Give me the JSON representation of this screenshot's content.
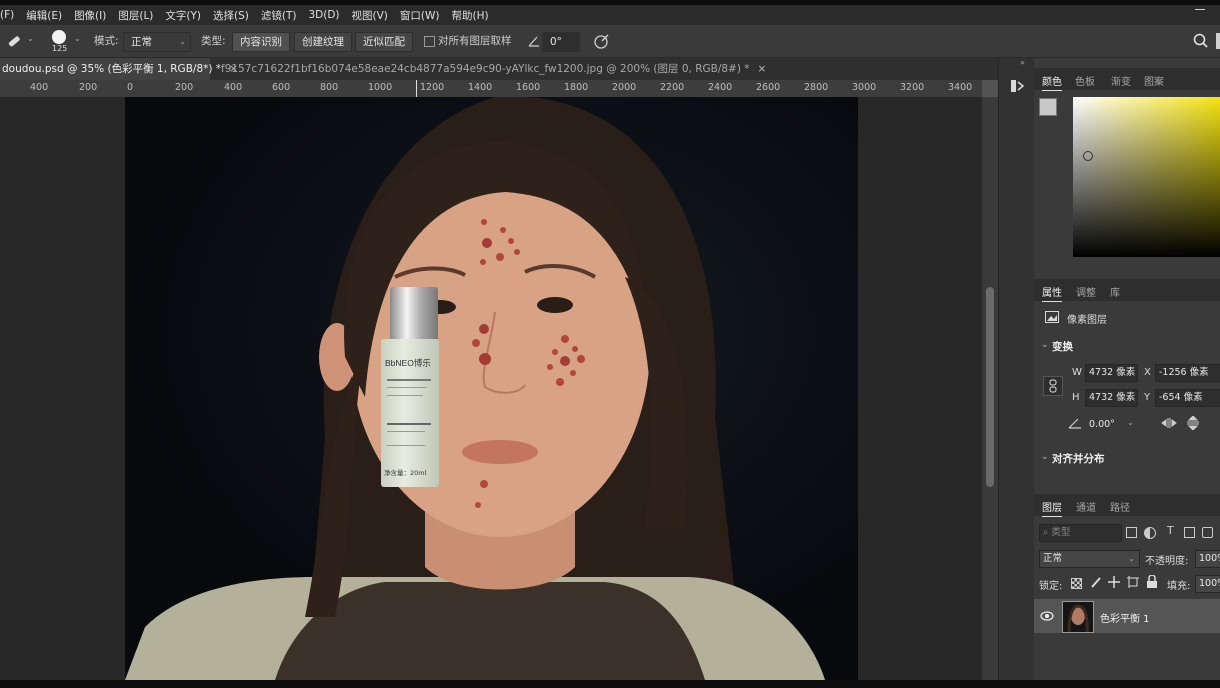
{
  "menu": [
    "(F)",
    "编辑(E)",
    "图像(I)",
    "图层(L)",
    "文字(Y)",
    "选择(S)",
    "滤镜(T)",
    "3D(D)",
    "视图(V)",
    "窗口(W)",
    "帮助(H)"
  ],
  "options": {
    "brush_size": "125",
    "mode_label": "模式:",
    "mode_value": "正常",
    "type_label": "类型:",
    "type_buttons": [
      "内容识别",
      "创建纹理",
      "近似匹配"
    ],
    "sample_all_label": "对所有图层取样",
    "angle_value": "0°"
  },
  "tabs": [
    {
      "label": "doudou.psd @ 35% (色彩平衡 1, RGB/8*) *",
      "close": "×"
    },
    {
      "label": "f9157c71622f1bf16b074e58eae24cb4877a594e9c90-yAYlkc_fw1200.jpg @ 200% (图层 0, RGB/8#) *",
      "close": "×"
    }
  ],
  "ruler_ticks": [
    "400",
    "200",
    "0",
    "200",
    "400",
    "600",
    "800",
    "1000",
    "1200",
    "1400",
    "1600",
    "1800",
    "2000",
    "2200",
    "2400",
    "2600",
    "2800",
    "3000",
    "3200",
    "3400"
  ],
  "product_label": "BbNEO博乐",
  "product_sub": "净含量：20ml",
  "color_panel": {
    "tabs": [
      "颜色",
      "色板",
      "渐变",
      "图案"
    ]
  },
  "properties": {
    "tabs": [
      "属性",
      "调整",
      "库"
    ],
    "layer_type": "像素图层",
    "transform_label": "变换",
    "w_label": "W",
    "w_value": "4732 像素",
    "x_label": "X",
    "x_value": "-1256 像素",
    "h_label": "H",
    "h_value": "4732 像素",
    "y_label": "Y",
    "y_value": "-654 像素",
    "angle_value": "0.00°",
    "align_label": "对齐并分布"
  },
  "layers": {
    "tabs": [
      "图层",
      "通道",
      "路径"
    ],
    "search_placeholder": "类型",
    "blend_mode": "正常",
    "opacity_label": "不透明度:",
    "opacity_value": "100%",
    "lock_label": "锁定:",
    "fill_label": "填充:",
    "fill_value": "100%",
    "layer_name": "色彩平衡 1"
  }
}
